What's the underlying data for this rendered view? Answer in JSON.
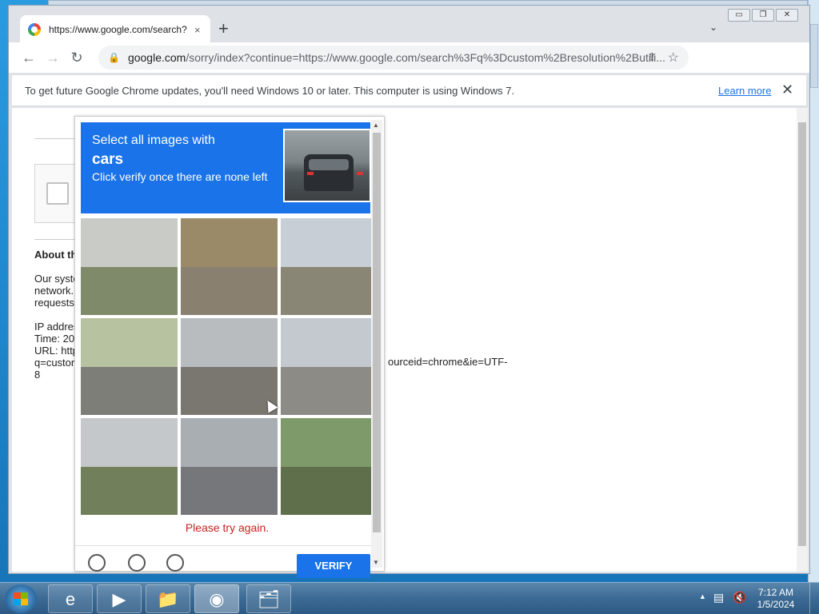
{
  "browser": {
    "tab_title": "https://www.google.com/search?",
    "tab_close": "×",
    "new_tab": "+",
    "tab_search": "⌄",
    "url_host": "google.com",
    "url_path": "/sorry/index?continue=https://www.google.com/search%3Fq%3Dcustom%2Bresolution%2Butili...",
    "back": "←",
    "forward": "→",
    "reload": "↻",
    "share": "⇪",
    "star": "☆",
    "menu": "⋮",
    "minimize": "▭",
    "restore": "❐",
    "close": "✕"
  },
  "infobar": {
    "message": "To get future Google Chrome updates, you'll need Windows 10 or later. This computer is using Windows 7.",
    "link": "Learn more",
    "close": "✕"
  },
  "page": {
    "about_heading": "About th",
    "para1_lines": [
      "Our syste",
      "network.",
      "requests"
    ],
    "para2_lines": [
      "IP addres",
      "Time: 20",
      "URL: http",
      "q=custor",
      "8"
    ],
    "url_tail": "ourceid=chrome&ie=UTF-"
  },
  "captcha": {
    "line1": "Select all images with",
    "target": "cars",
    "line3": "Click verify once there are none left",
    "error": "Please try again.",
    "verify": "VERIFY",
    "tiles": [
      {
        "name": "palm-street",
        "sky": "#c9ccc6",
        "ground": "#7f8a6a"
      },
      {
        "name": "road-guardrail",
        "sky": "#9a8a68",
        "ground": "#8a8070"
      },
      {
        "name": "highway-ramp",
        "sky": "#c7ced5",
        "ground": "#8a8676"
      },
      {
        "name": "tree-street",
        "sky": "#b7c2a0",
        "ground": "#7d7e78"
      },
      {
        "name": "palm-tree",
        "sky": "#b8bcbe",
        "ground": "#7a7670"
      },
      {
        "name": "intersection",
        "sky": "#c3c9cf",
        "ground": "#8c8b86"
      },
      {
        "name": "trees-road",
        "sky": "#c5c8cb",
        "ground": "#71805a"
      },
      {
        "name": "traffic-cars",
        "sky": "#a9aeb2",
        "ground": "#76777a"
      },
      {
        "name": "traffic-light",
        "sky": "#7f9a6a",
        "ground": "#5f6f4b"
      }
    ]
  },
  "taskbar": {
    "items": [
      "e",
      "▶",
      "📁",
      "◉",
      "🗂"
    ],
    "time": "7:12 AM",
    "date": "1/5/2024"
  }
}
